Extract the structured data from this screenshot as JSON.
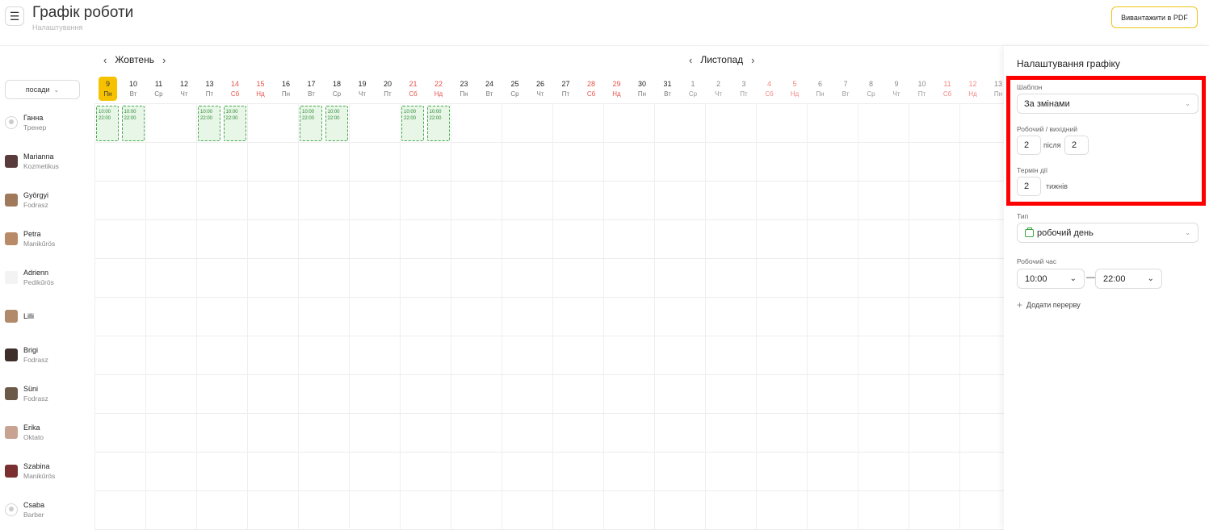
{
  "header": {
    "title": "Графік роботи",
    "subtitle": "Налаштування",
    "pdf_button": "Вивантажити в PDF",
    "menu_icon": "☰"
  },
  "nav": {
    "prev": "‹",
    "next": "›",
    "months": [
      "Жовтень",
      "Листопад"
    ]
  },
  "filter": {
    "label": "посади",
    "caret": "⌄"
  },
  "days": [
    {
      "n": "9",
      "d": "Пн",
      "we": false,
      "today": true,
      "faded": false
    },
    {
      "n": "10",
      "d": "Вт",
      "we": false,
      "today": false,
      "faded": false
    },
    {
      "n": "11",
      "d": "Ср",
      "we": false,
      "today": false,
      "faded": false
    },
    {
      "n": "12",
      "d": "Чт",
      "we": false,
      "today": false,
      "faded": false
    },
    {
      "n": "13",
      "d": "Пт",
      "we": false,
      "today": false,
      "faded": false
    },
    {
      "n": "14",
      "d": "Сб",
      "we": true,
      "today": false,
      "faded": false
    },
    {
      "n": "15",
      "d": "Нд",
      "we": true,
      "today": false,
      "faded": false
    },
    {
      "n": "16",
      "d": "Пн",
      "we": false,
      "today": false,
      "faded": false
    },
    {
      "n": "17",
      "d": "Вт",
      "we": false,
      "today": false,
      "faded": false
    },
    {
      "n": "18",
      "d": "Ср",
      "we": false,
      "today": false,
      "faded": false
    },
    {
      "n": "19",
      "d": "Чт",
      "we": false,
      "today": false,
      "faded": false
    },
    {
      "n": "20",
      "d": "Пт",
      "we": false,
      "today": false,
      "faded": false
    },
    {
      "n": "21",
      "d": "Сб",
      "we": true,
      "today": false,
      "faded": false
    },
    {
      "n": "22",
      "d": "Нд",
      "we": true,
      "today": false,
      "faded": false
    },
    {
      "n": "23",
      "d": "Пн",
      "we": false,
      "today": false,
      "faded": false
    },
    {
      "n": "24",
      "d": "Вт",
      "we": false,
      "today": false,
      "faded": false
    },
    {
      "n": "25",
      "d": "Ср",
      "we": false,
      "today": false,
      "faded": false
    },
    {
      "n": "26",
      "d": "Чт",
      "we": false,
      "today": false,
      "faded": false
    },
    {
      "n": "27",
      "d": "Пт",
      "we": false,
      "today": false,
      "faded": false
    },
    {
      "n": "28",
      "d": "Сб",
      "we": true,
      "today": false,
      "faded": false
    },
    {
      "n": "29",
      "d": "Нд",
      "we": true,
      "today": false,
      "faded": false
    },
    {
      "n": "30",
      "d": "Пн",
      "we": false,
      "today": false,
      "faded": false
    },
    {
      "n": "31",
      "d": "Вт",
      "we": false,
      "today": false,
      "faded": false
    },
    {
      "n": "1",
      "d": "Ср",
      "we": false,
      "today": false,
      "faded": true
    },
    {
      "n": "2",
      "d": "Чт",
      "we": false,
      "today": false,
      "faded": true
    },
    {
      "n": "3",
      "d": "Пт",
      "we": false,
      "today": false,
      "faded": true
    },
    {
      "n": "4",
      "d": "Сб",
      "we": true,
      "today": false,
      "faded": true
    },
    {
      "n": "5",
      "d": "Нд",
      "we": true,
      "today": false,
      "faded": true
    },
    {
      "n": "6",
      "d": "Пн",
      "we": false,
      "today": false,
      "faded": true
    },
    {
      "n": "7",
      "d": "Вт",
      "we": false,
      "today": false,
      "faded": true
    },
    {
      "n": "8",
      "d": "Ср",
      "we": false,
      "today": false,
      "faded": true
    },
    {
      "n": "9",
      "d": "Чт",
      "we": false,
      "today": false,
      "faded": true
    },
    {
      "n": "10",
      "d": "Пт",
      "we": false,
      "today": false,
      "faded": true
    },
    {
      "n": "11",
      "d": "Сб",
      "we": true,
      "today": false,
      "faded": true
    },
    {
      "n": "12",
      "d": "Нд",
      "we": true,
      "today": false,
      "faded": true
    },
    {
      "n": "13",
      "d": "Пн",
      "we": false,
      "today": false,
      "faded": true
    }
  ],
  "employees": [
    {
      "name": "Ганна",
      "role": "Тренер",
      "avatar": "placeholder"
    },
    {
      "name": "Marianna",
      "role": "Kozmetikus",
      "avatar": "photo",
      "color": "#5a3b3b"
    },
    {
      "name": "Györgyi",
      "role": "Fodrasz",
      "avatar": "photo",
      "color": "#a0785a"
    },
    {
      "name": "Petra",
      "role": "Manikűrös",
      "avatar": "photo",
      "color": "#b98a68"
    },
    {
      "name": "Adrienn",
      "role": "Pedikűrös",
      "avatar": "doc"
    },
    {
      "name": "Lilli",
      "role": "",
      "avatar": "photo",
      "color": "#b08a6a"
    },
    {
      "name": "Brigi",
      "role": "Fodrasz",
      "avatar": "photo",
      "color": "#3d2e2a"
    },
    {
      "name": "Süni",
      "role": "Fodrasz",
      "avatar": "photo",
      "color": "#6b5a48"
    },
    {
      "name": "Erika",
      "role": "Oktato",
      "avatar": "photo",
      "color": "#c9a391"
    },
    {
      "name": "Szabina",
      "role": "Manikűrös",
      "avatar": "photo",
      "color": "#7a3030"
    },
    {
      "name": "Csaba",
      "role": "Barber",
      "avatar": "placeholder"
    }
  ],
  "shifts": [
    {
      "day": 0,
      "start": "10:00",
      "end": "22:00"
    },
    {
      "day": 1,
      "start": "10:00",
      "end": "22:00"
    },
    {
      "day": 4,
      "start": "10:00",
      "end": "22:00"
    },
    {
      "day": 5,
      "start": "10:00",
      "end": "22:00"
    },
    {
      "day": 8,
      "start": "10:00",
      "end": "22:00"
    },
    {
      "day": 9,
      "start": "10:00",
      "end": "22:00"
    },
    {
      "day": 12,
      "start": "10:00",
      "end": "22:00"
    },
    {
      "day": 13,
      "start": "10:00",
      "end": "22:00"
    }
  ],
  "panel": {
    "title": "Налаштування графіку",
    "template_label": "Шаблон",
    "template_value": "За змінами",
    "workoff_label": "Робочий / вихідний",
    "work_days": "2",
    "after_text": "після",
    "off_days": "2",
    "term_label": "Термін дії",
    "term_value": "2",
    "term_unit": "тижнів",
    "type_label": "Тип",
    "type_value": "робочий день",
    "hours_label": "Робочий час",
    "start_time": "10:00",
    "end_time": "22:00",
    "time_dash": "—",
    "add_break": "Додати перерву",
    "plus": "+",
    "caret": "⌄"
  },
  "colors": {
    "accent": "#f6c200",
    "weekend": "#e5534b",
    "shift_border": "#47a84d",
    "shift_bg": "#e7f6e7",
    "highlight": "#ff0000"
  }
}
